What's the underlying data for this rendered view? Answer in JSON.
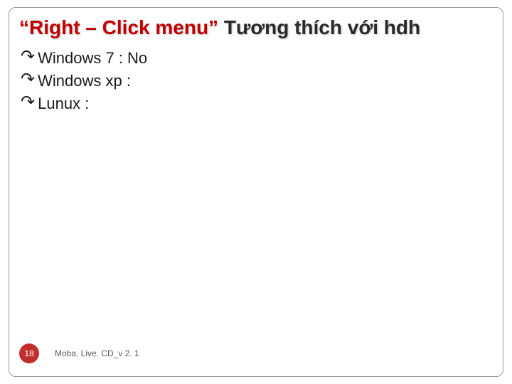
{
  "title": {
    "red": "“Right – Click menu”",
    "rest": " Tương thích với hdh"
  },
  "bullets": [
    {
      "text": "Windows 7 : No"
    },
    {
      "text": "Windows xp :"
    },
    {
      "text": "Lunux :"
    }
  ],
  "footer": {
    "page": "18",
    "label": "Moba. Live. CD_v 2. 1"
  }
}
